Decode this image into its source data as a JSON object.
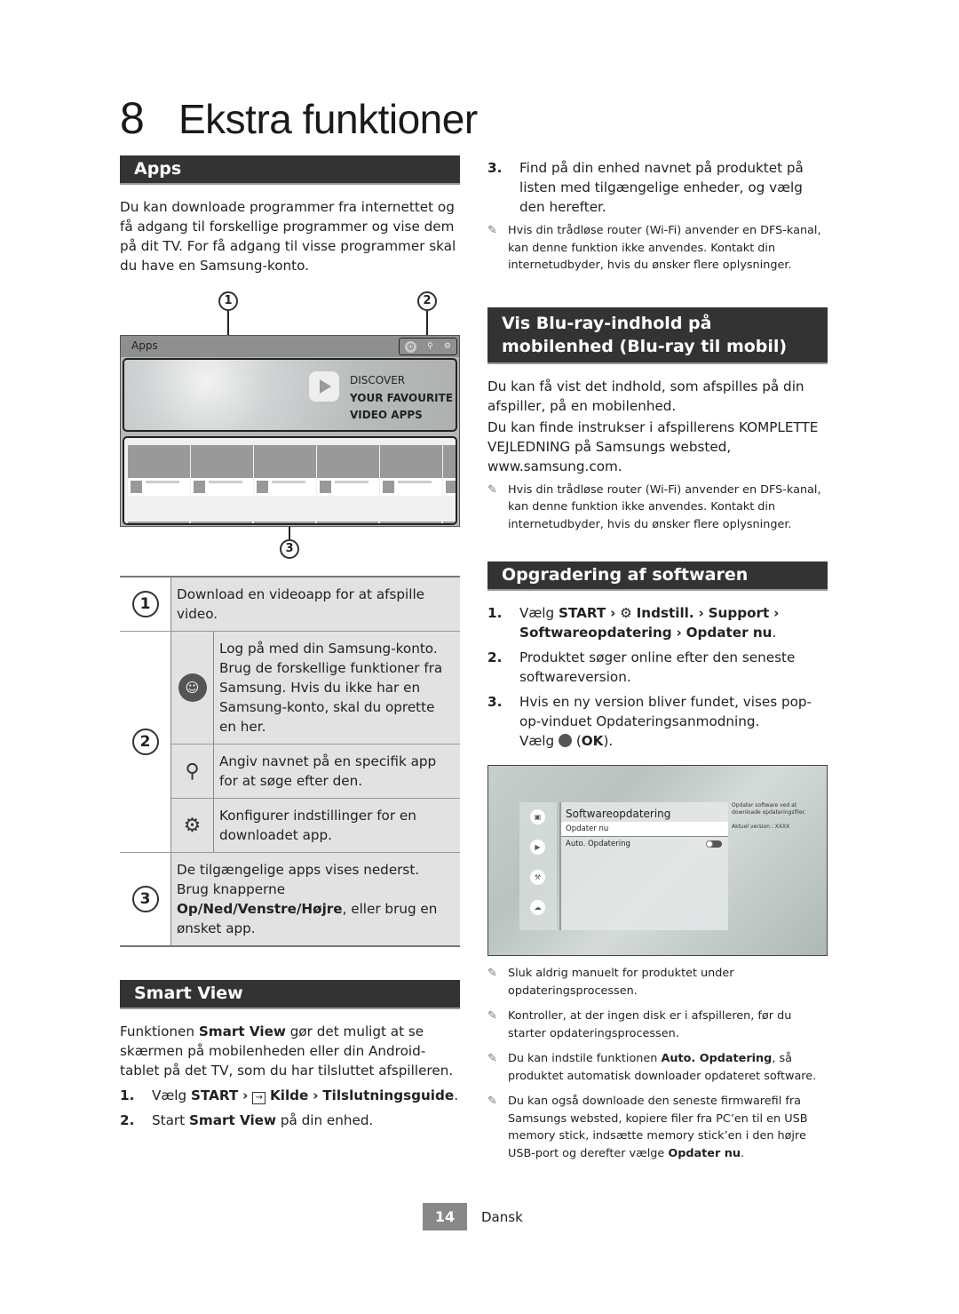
{
  "chapter": {
    "number": "8",
    "title": "Ekstra funktioner"
  },
  "apps": {
    "heading": "Apps",
    "intro": "Du kan downloade programmer fra internettet og få adgang til forskellige programmer og vise dem på dit TV. For få adgang til visse programmer skal du have en Samsung-konto.",
    "figure": {
      "callouts": [
        "1",
        "2",
        "3"
      ],
      "bar_title": "Apps",
      "icons": [
        "account-icon",
        "search-icon",
        "gear-icon"
      ],
      "banner_lines": [
        "DISCOVER",
        "YOUR FAVOURITE",
        "VIDEO APPS"
      ]
    },
    "legend": [
      {
        "num": "1",
        "text": "Download en videoapp for at afspille video."
      },
      {
        "num": "2",
        "items": [
          {
            "icon": "account-icon",
            "text": "Log på med din Samsung-konto. Brug de forskellige funktioner fra Samsung. Hvis du ikke har en Samsung-konto, skal du oprette en her."
          },
          {
            "icon": "search-icon",
            "text": "Angiv navnet på en specifik app for at søge efter den."
          },
          {
            "icon": "gear-icon",
            "text": "Konfigurer indstillinger for en downloadet app."
          }
        ]
      },
      {
        "num": "3",
        "text_pre": "De tilgængelige apps vises nederst. Brug knapperne ",
        "text_bold": "Op/Ned/Venstre/Højre",
        "text_post": ", eller brug en ønsket app."
      }
    ]
  },
  "smart_view": {
    "heading": "Smart View",
    "intro_pre": "Funktionen ",
    "intro_bold": "Smart View",
    "intro_post": " gør det muligt at se skærmen på mobilenheden eller din Android-tablet på det TV, som du har tilsluttet afspilleren.",
    "steps": [
      {
        "n": "1.",
        "pre": "Vælg ",
        "b1": "START",
        "sep": ">",
        "icon": "source-icon",
        "b2": "Kilde",
        "b3": "Tilslutningsguide",
        "post": "."
      },
      {
        "n": "2.",
        "pre": "Start ",
        "bold": "Smart View",
        "post": " på din enhed."
      },
      {
        "n": "3.",
        "text": "Find på din enhed navnet på produktet på listen med tilgængelige enheder, og vælg den herefter."
      }
    ],
    "note": "Hvis din trådløse router (Wi-Fi) anvender en DFS-kanal, kan denne funktion ikke anvendes. Kontakt din internetudbyder, hvis du ønsker flere oplysninger."
  },
  "bluray_mobile": {
    "heading": "Vis Blu-ray-indhold på mobilenhed (Blu-ray til mobil)",
    "para1": "Du kan få vist det indhold, som afspilles på din afspiller, på en mobilenhed.",
    "para2": "Du kan finde instrukser i afspillerens KOMPLETTE VEJLEDNING på Samsungs websted, www.samsung.com.",
    "note": "Hvis din trådløse router (Wi-Fi) anvender en DFS-kanal, kan denne funktion ikke anvendes. Kontakt din internetudbyder, hvis du ønsker flere oplysninger."
  },
  "upgrade": {
    "heading": "Opgradering af softwaren",
    "steps": [
      {
        "n": "1.",
        "pre": "Vælg ",
        "b1": "START",
        "b2": "Indstill.",
        "b3": "Support",
        "b4": "Softwareopdatering",
        "b5": "Opdater nu",
        "post": "."
      },
      {
        "n": "2.",
        "text": "Produktet søger online efter den seneste softwareversion."
      },
      {
        "n": "3.",
        "text": "Hvis en ny version bliver fundet, vises pop-op-vinduet Opdateringsanmodning.",
        "pre2": "Vælg ",
        "bold": "OK"
      }
    ],
    "screen": {
      "title": "Softwareopdatering",
      "items": [
        "Opdater nu",
        "Auto. Opdatering"
      ],
      "auto_update_on": false,
      "info": "Opdater software ved at downloade opdateringsfiler.",
      "version": "Aktuel version : XXXX",
      "side_icons": [
        "picture-icon",
        "sound-icon",
        "wrench-icon",
        "support-icon"
      ]
    },
    "notes": [
      {
        "text": "Sluk aldrig manuelt for produktet under opdateringsprocessen."
      },
      {
        "text": "Kontroller, at der ingen disk er i afspilleren, før du starter opdateringsprocessen."
      },
      {
        "pre": "Du kan indstile funktionen ",
        "bold": "Auto. Opdatering",
        "post": ", så produktet automatisk downloader opdateret software."
      },
      {
        "pre": "Du kan også downloade den seneste firmwarefil fra Samsungs websted, kopiere filer fra PC’en til en USB memory stick, indsætte memory stick’en i den højre USB-port og derefter vælge ",
        "bold": "Opdater nu",
        "post": "."
      }
    ]
  },
  "footer": {
    "page": "14",
    "language": "Dansk"
  }
}
